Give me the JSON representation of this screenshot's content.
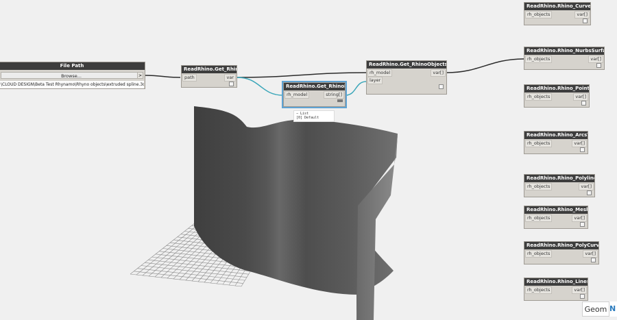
{
  "file_path_node": {
    "title": "File Path",
    "browse_label": "Browse...",
    "output_arrow": ">",
    "path_value": "\\CLOUD DESIGN\\Beta Test Rhynamo\\Rhyno objects\\extruded spline.3dm"
  },
  "get_rhinofile_node": {
    "title": "ReadRhino.Get_RhinoFile",
    "input": "path",
    "output": "var"
  },
  "get_rhinolayers_node": {
    "title": "ReadRhino.Get_RhinoLayers",
    "input": "rh_model",
    "output": "string[]"
  },
  "get_objectsbylayer_node": {
    "title": "ReadRhino.Get_RhinoObjectsByLayer",
    "inputs": [
      "rh_model",
      "layer"
    ],
    "output": "var[]"
  },
  "layer_preview": {
    "lines": [
      "−  List",
      "   [0] Default"
    ]
  },
  "right_nodes": [
    {
      "title": "ReadRhino.Rhino_CurvesToDS",
      "input": "rh_objects",
      "output": "var[]"
    },
    {
      "title": "ReadRhino.Rhino_NurbsSurfaceToDS",
      "input": "rh_objects",
      "output": "var[]"
    },
    {
      "title": "ReadRhino.Rhino_PointsToDS",
      "input": "rh_objects",
      "output": "var[]"
    },
    {
      "title": "ReadRhino.Rhino_ArcsToDS",
      "input": "rh_objects",
      "output": "var[]"
    },
    {
      "title": "ReadRhino.Rhino_PolylinesToDS",
      "input": "rh_objects",
      "output": "var[]"
    },
    {
      "title": "ReadRhino.Rhino_MeshToDS",
      "input": "rh_objects",
      "output": "var[]"
    },
    {
      "title": "ReadRhino.Rhino_PolyCurvesToDS",
      "input": "rh_objects",
      "output": "var[]"
    },
    {
      "title": "ReadRhino.Rhino_LinesToDS",
      "input": "rh_objects",
      "output": "var[]"
    }
  ],
  "mode_tabs": {
    "geom_label": "Geom",
    "node_label": "N"
  },
  "colors": {
    "canvas_bg": "#f0f0f0",
    "node_body": "#d6d3cd",
    "node_header": "#3d3d3d",
    "selection": "#5fa3d3",
    "wire_dark": "#2b2b2b",
    "wire_selected": "#3aa6b9",
    "surface": "#505050"
  }
}
